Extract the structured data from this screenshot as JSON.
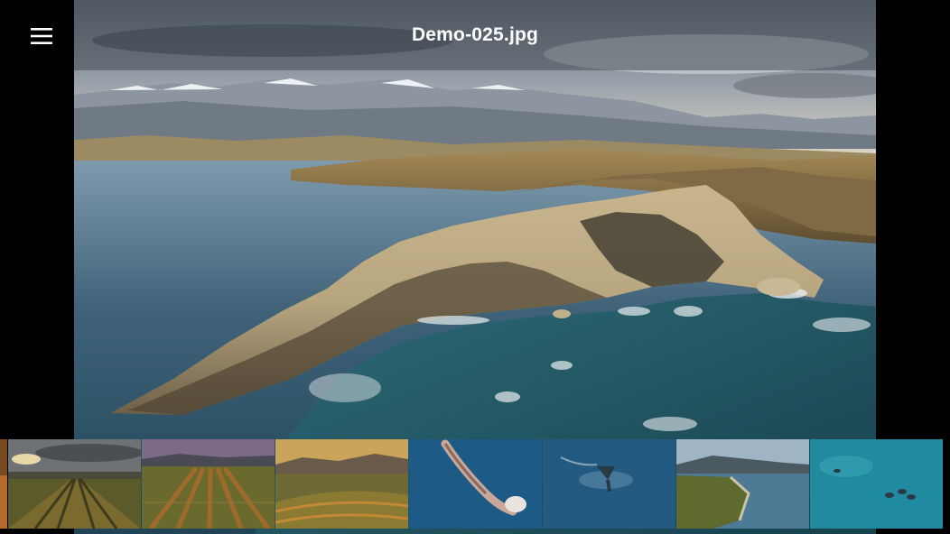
{
  "viewer": {
    "title": "Demo-025.jpg"
  },
  "menu": {
    "icon": "hamburger-menu-icon"
  },
  "main_image": {
    "description_icon": "coastal-cliffs-aerial-photo"
  },
  "filmstrip": {
    "thumbnails": [
      {
        "id": "t0",
        "subject": "edge-sliver"
      },
      {
        "id": "t1",
        "subject": "vineyard-sunset"
      },
      {
        "id": "t2",
        "subject": "vineyard-rows"
      },
      {
        "id": "t3",
        "subject": "vineyard-hills"
      },
      {
        "id": "t4",
        "subject": "whale-aerial"
      },
      {
        "id": "t5",
        "subject": "whale-tail"
      },
      {
        "id": "t6",
        "subject": "coastal-bay"
      },
      {
        "id": "t7",
        "subject": "dolphins-ocean"
      }
    ]
  },
  "colors": {
    "background": "#000000",
    "title_overlay": "#464e58",
    "title_text": "#ffffff"
  }
}
